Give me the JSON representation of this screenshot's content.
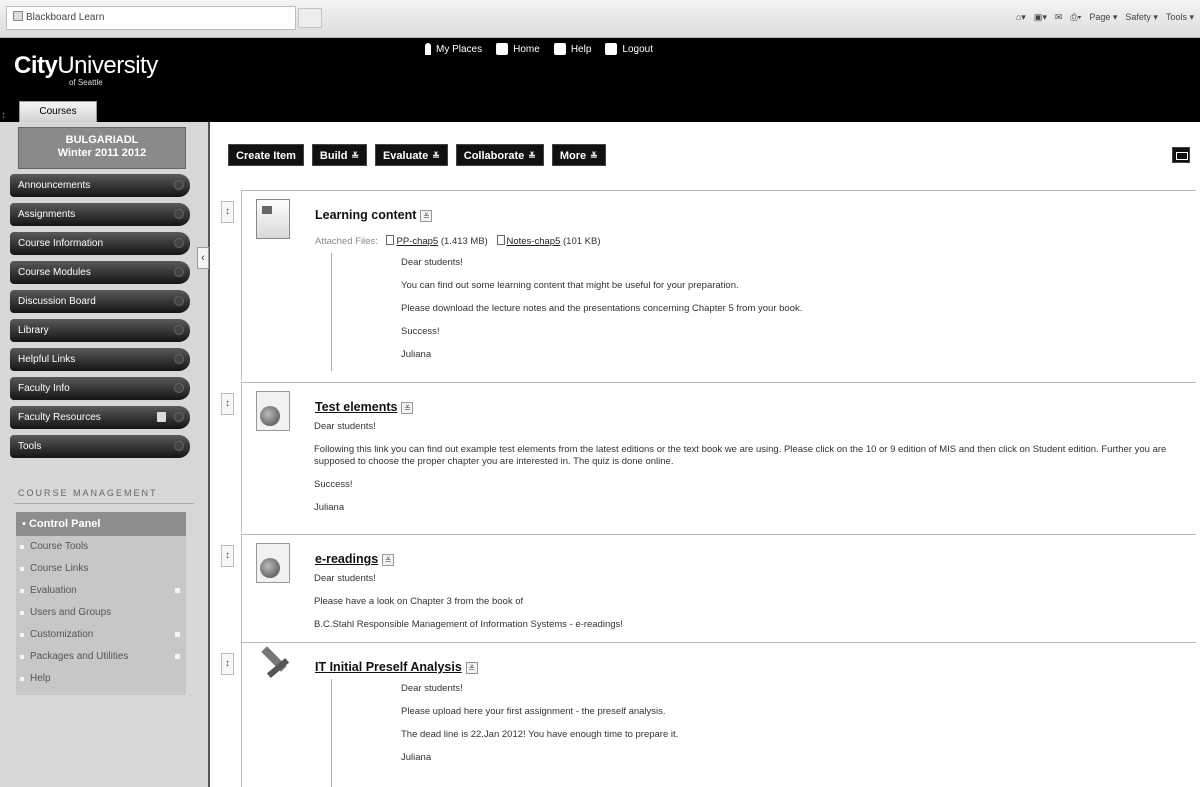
{
  "browser": {
    "tab_title": "Blackboard Learn",
    "commands": [
      "Page ▾",
      "Safety ▾",
      "Tools ▾"
    ]
  },
  "header": {
    "logo_bold": "City",
    "logo_regular": "University",
    "logo_sub": "of Seattle",
    "nav": [
      "My Places",
      "Home",
      "Help",
      "Logout"
    ],
    "courses_tab": "Courses"
  },
  "sidebar": {
    "course_line1": "BULGARIADL",
    "course_line2": "Winter 2011 2012",
    "menu": [
      "Announcements",
      "Assignments",
      "Course Information",
      "Course Modules",
      "Discussion Board",
      "Library",
      "Helpful Links",
      "Faculty Info",
      "Faculty Resources",
      "Tools"
    ],
    "management_header": "COURSE MANAGEMENT",
    "control_panel": "Control Panel",
    "control_items": [
      "Course Tools",
      "Course Links",
      "Evaluation",
      "Users and Groups",
      "Customization",
      "Packages and Utilities",
      "Help"
    ]
  },
  "toolbar": {
    "create_item": "Create Item",
    "build": "Build",
    "evaluate": "Evaluate",
    "collaborate": "Collaborate",
    "more": "More"
  },
  "items": [
    {
      "title": "Learning content",
      "attached_label": "Attached Files:",
      "file1_name": "PP-chap5",
      "file1_size": "(1.413 MB)",
      "file2_name": "Notes-chap5",
      "file2_size": "(101 KB)",
      "body": [
        "Dear students!",
        "You can find out some learning content that might be useful for your preparation.",
        "Please download the lecture notes and  the presentations concerning Chapter 5 from your book.",
        "Success!",
        "Juliana"
      ]
    },
    {
      "title": "Test elements",
      "body": [
        "Dear students!",
        "Following this link you can find out example test elements from the latest editions or the text book we are using. Please click on the 10 or 9 edition of MIS and then click on Student edition. Further you are supposed to choose  the proper chapter you are interested in. The quiz is done online.",
        "Success!",
        "Juliana"
      ]
    },
    {
      "title": "e-readings",
      "body": [
        "Dear students!",
        "Please have a look on Chapter 3 from the  book of",
        "B.C.Stahl Responsible Management of Information Systems - e-readings!"
      ]
    },
    {
      "title": "IT Initial Preself Analysis",
      "body": [
        "Dear students!",
        "Please upload here your first assignment - the preself analysis.",
        "The dead line is 22.Jan 2012! You have enough time to prepare it.",
        "Juliana"
      ]
    }
  ]
}
